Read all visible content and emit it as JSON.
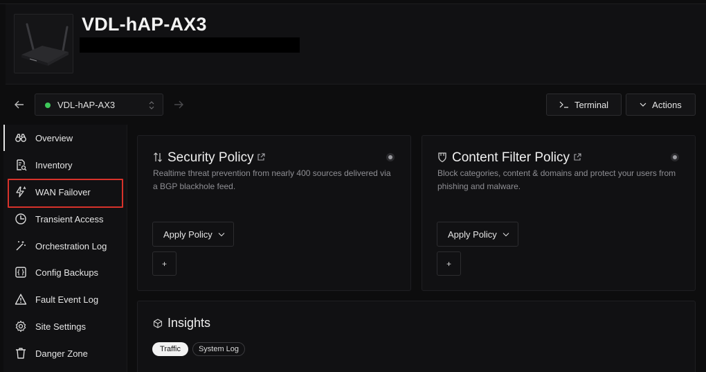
{
  "header": {
    "device_name": "VDL-hAP-AX3"
  },
  "toolbar": {
    "selected_device": "VDL-hAP-AX3",
    "status_color": "#3ec85a",
    "terminal_label": "Terminal",
    "actions_label": "Actions"
  },
  "sidebar": {
    "items": [
      {
        "label": "Overview",
        "icon": "binoculars-icon"
      },
      {
        "label": "Inventory",
        "icon": "inventory-search-icon"
      },
      {
        "label": "WAN Failover",
        "icon": "lightning-icon"
      },
      {
        "label": "Transient Access",
        "icon": "clock-pie-icon"
      },
      {
        "label": "Orchestration Log",
        "icon": "magic-wand-icon"
      },
      {
        "label": "Config Backups",
        "icon": "braces-file-icon"
      },
      {
        "label": "Fault Event Log",
        "icon": "warning-icon"
      },
      {
        "label": "Site Settings",
        "icon": "gear-icon"
      },
      {
        "label": "Danger Zone",
        "icon": "trash-icon"
      }
    ],
    "highlight_color": "#d8322b"
  },
  "cards": {
    "security": {
      "title": "Security Policy",
      "description": "Realtime threat prevention from nearly 400 sources delivered via a BGP blackhole feed.",
      "apply_label": "Apply Policy",
      "plus": "+"
    },
    "content_filter": {
      "title": "Content Filter Policy",
      "description": "Block categories, content & domains and protect your users from phishing and malware.",
      "apply_label": "Apply Policy",
      "plus": "+"
    }
  },
  "insights": {
    "title": "Insights",
    "tabs": [
      "Traffic",
      "System Log"
    ]
  }
}
